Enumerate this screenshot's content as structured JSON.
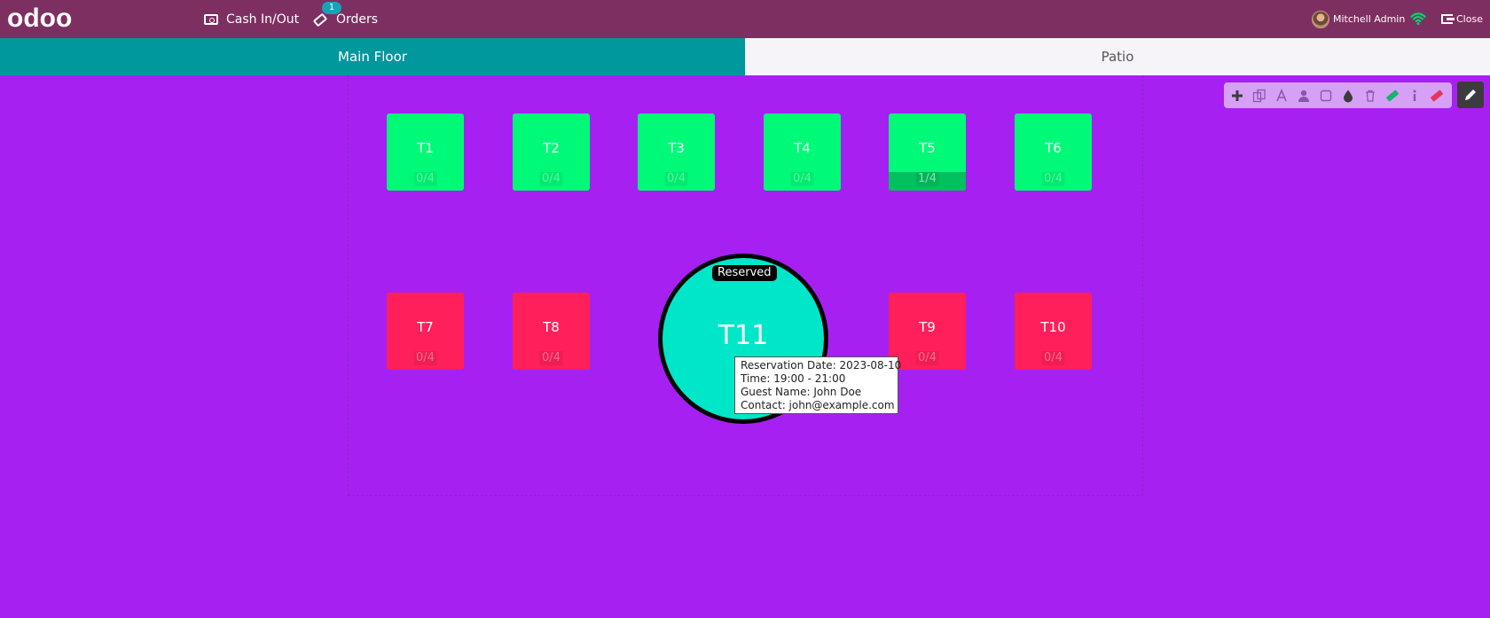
{
  "navbar": {
    "logo_text": "odoo",
    "cash_label": "Cash In/Out",
    "orders_label": "Orders",
    "orders_badge": "1",
    "user_name": "Mitchell Admin",
    "close_label": "Close",
    "wifi_icon": "wifi-icon"
  },
  "floors": {
    "tabs": [
      {
        "label": "Main Floor",
        "active": true
      },
      {
        "label": "Patio",
        "active": false
      }
    ]
  },
  "tables": [
    {
      "name": "T1",
      "seats": "0/4",
      "status": "free"
    },
    {
      "name": "T2",
      "seats": "0/4",
      "status": "free"
    },
    {
      "name": "T3",
      "seats": "0/4",
      "status": "free"
    },
    {
      "name": "T4",
      "seats": "0/4",
      "status": "free"
    },
    {
      "name": "T5",
      "seats": "1/4",
      "status": "occupied"
    },
    {
      "name": "T6",
      "seats": "0/4",
      "status": "free"
    },
    {
      "name": "T7",
      "seats": "0/4",
      "status": "red"
    },
    {
      "name": "T8",
      "seats": "0/4",
      "status": "red"
    },
    {
      "name": "T9",
      "seats": "0/4",
      "status": "red"
    },
    {
      "name": "T10",
      "seats": "0/4",
      "status": "red"
    },
    {
      "name": "T11",
      "status": "reserved",
      "badge": "Reserved"
    }
  ],
  "tooltip": {
    "date": "Reservation Date: 2023-08-10",
    "time": "Time: 19:00 - 21:00",
    "guest": "Guest Name: John Doe",
    "contact": "Contact: john@example.com"
  },
  "toolbar": {
    "tools": [
      "plus-icon",
      "copy-icon",
      "font-icon",
      "user-icon",
      "square-icon",
      "tint-icon",
      "trash-icon",
      "ticket-green-icon",
      "info-icon",
      "ticket-red-icon"
    ],
    "edit_icon": "pencil-icon"
  },
  "colors": {
    "navbar": "#7e2f61",
    "floor_background": "#a620f2",
    "tab_active": "#00979d",
    "table_green": "#00fa78",
    "table_red": "#ff1f5a",
    "table_round": "#00e6c8"
  }
}
